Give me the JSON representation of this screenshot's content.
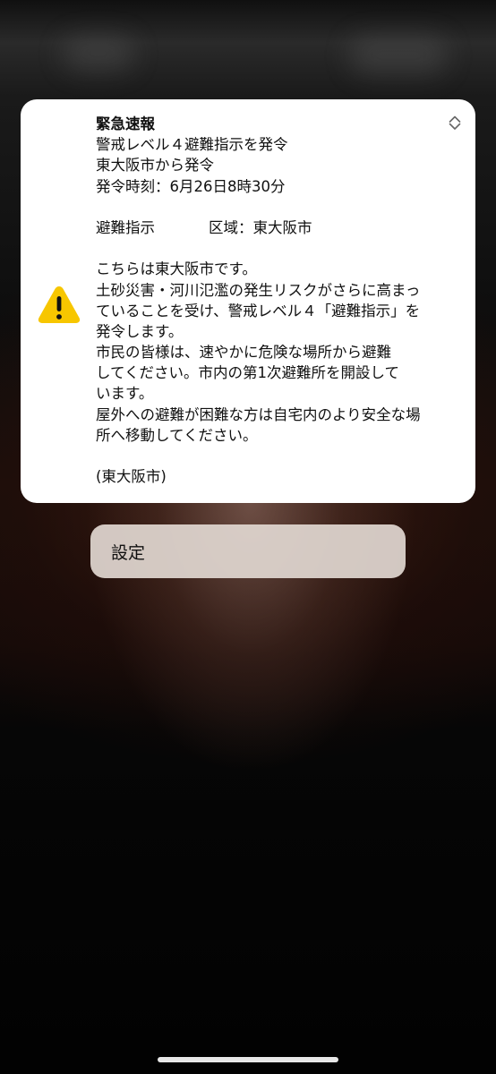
{
  "alert": {
    "title": "緊急速報",
    "lines": {
      "l1": "警戒レベル４避難指示を発令",
      "l2": "東大阪市から発令",
      "l3": "発令時刻：6月26日8時30分",
      "type_label": "避難指示",
      "area_label": "区域：東大阪市",
      "l5": "こちらは東大阪市です。",
      "l6": "土砂災害・河川氾濫の発生リスクがさらに高まっ",
      "l7": "ていることを受け、警戒レベル４「避難指示」を",
      "l8": "発令します。",
      "l9": "市民の皆様は、速やかに危険な場所から避難",
      "l10": "してください。市内の第1次避難所を開設して",
      "l11": "います。",
      "l12": "屋外への避難が困難な方は自宅内のより安全な場",
      "l13": "所へ移動してください。",
      "l15": "(東大阪市)"
    },
    "icon": "warning-triangle-icon",
    "icon_color": "#f7c600"
  },
  "settings_button": {
    "label": "設定"
  }
}
